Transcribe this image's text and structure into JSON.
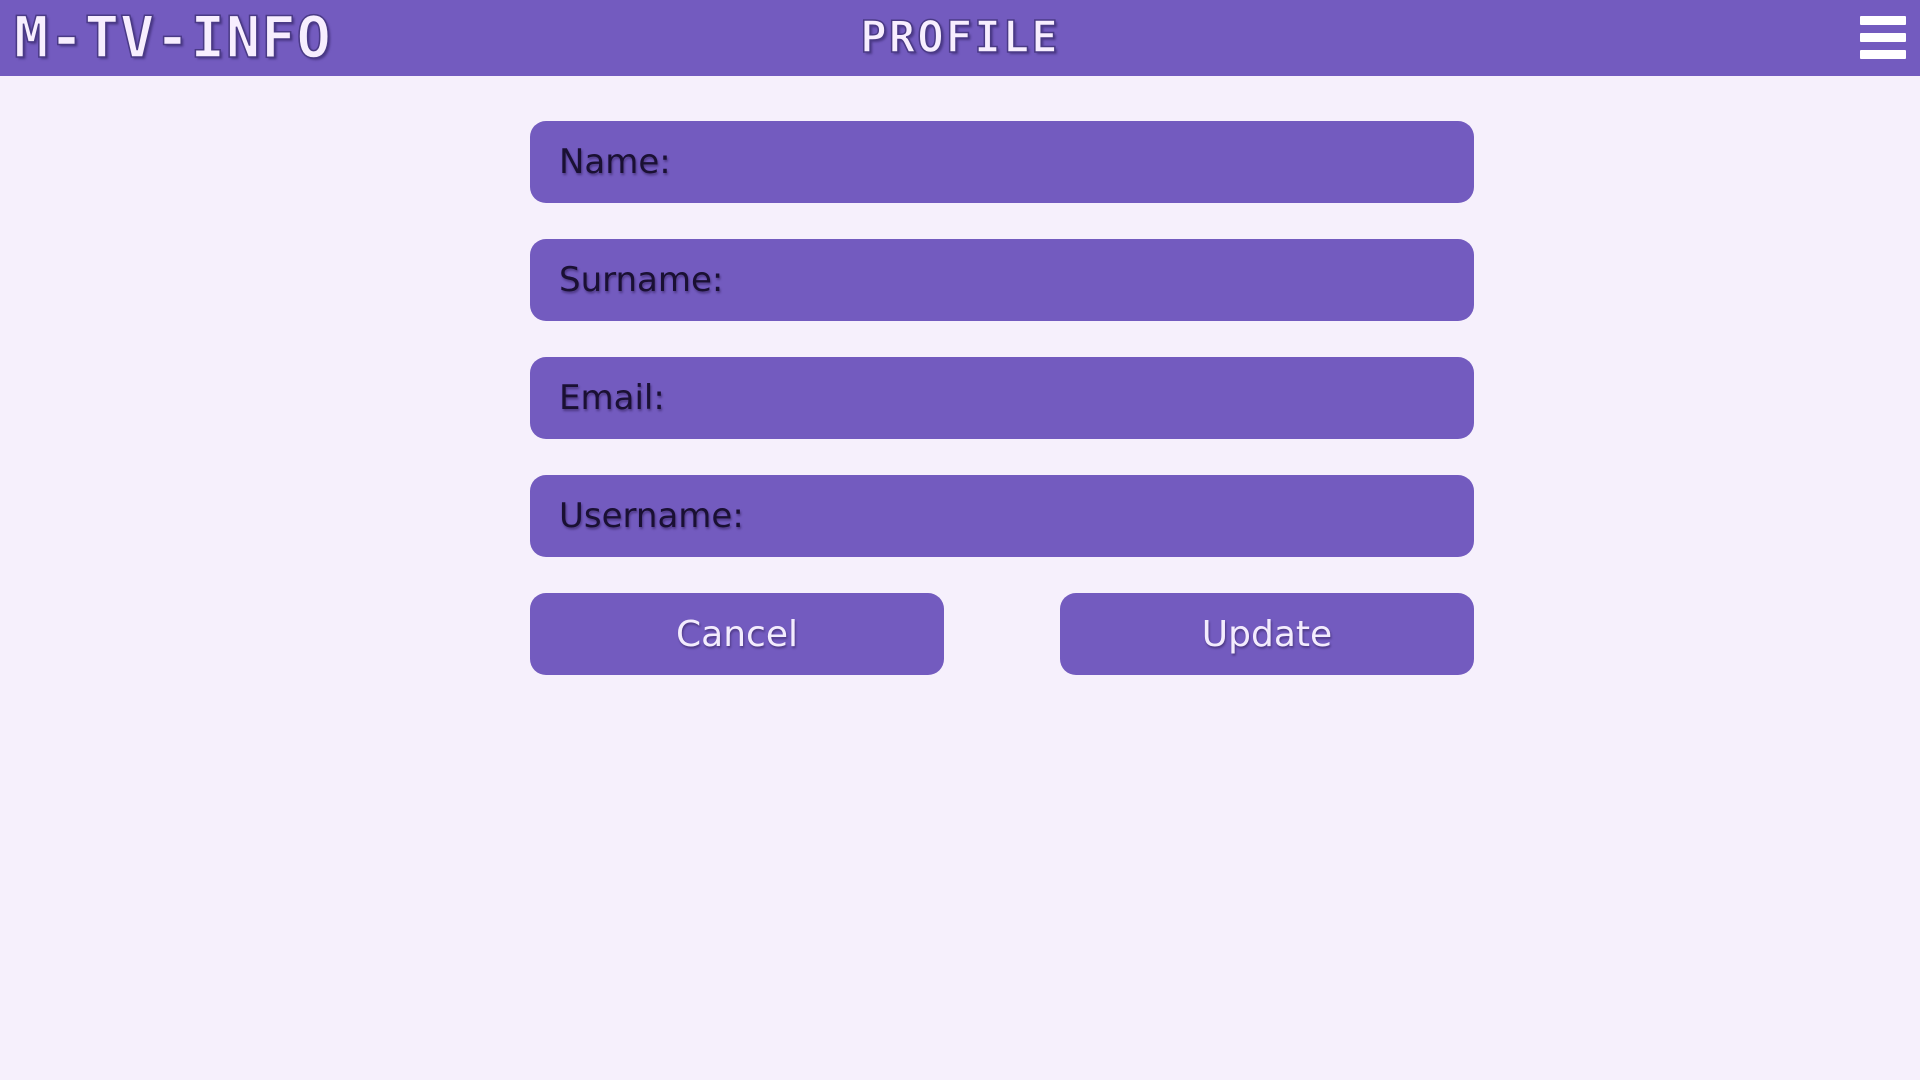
{
  "header": {
    "brand": "M-TV-INFO",
    "title": "PROFILE",
    "menu_icon": "hamburger-menu-icon"
  },
  "form": {
    "fields": [
      {
        "label": "Name:",
        "value": ""
      },
      {
        "label": "Surname:",
        "value": ""
      },
      {
        "label": "Email:",
        "value": ""
      },
      {
        "label": "Username:",
        "value": ""
      }
    ],
    "cancel_label": "Cancel",
    "update_label": "Update"
  },
  "colors": {
    "accent": "#735bbf",
    "background": "#f6f0fc",
    "header_text": "#f7eefe"
  }
}
